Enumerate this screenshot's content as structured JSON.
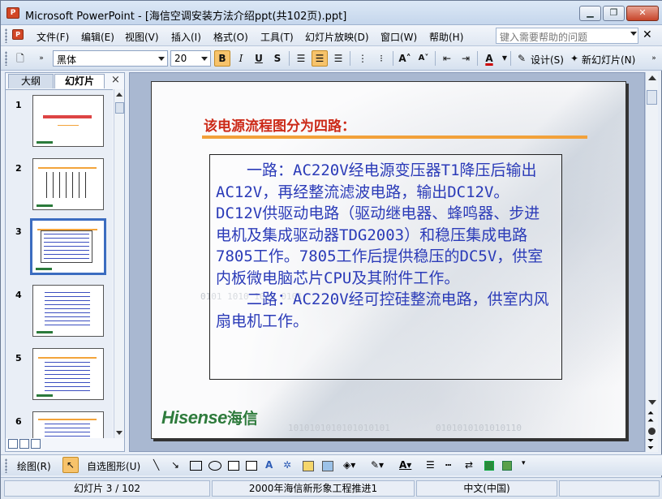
{
  "window": {
    "title": "Microsoft PowerPoint - [海信空调安装方法介绍ppt(共102页).ppt]",
    "icon_label": "P"
  },
  "menu": {
    "items": [
      "文件(F)",
      "编辑(E)",
      "视图(V)",
      "插入(I)",
      "格式(O)",
      "工具(T)",
      "幻灯片放映(D)",
      "窗口(W)",
      "帮助(H)"
    ],
    "help_placeholder": "键入需要帮助的问题",
    "close_glyph": "✕"
  },
  "toolbar": {
    "font_name": "黑体",
    "font_size": "20",
    "bold": "B",
    "italic": "I",
    "underline": "U",
    "shadow": "S",
    "design_label": "设计(S)",
    "new_slide_label": "新幻灯片(N)"
  },
  "left_pane": {
    "tab_outline": "大纲",
    "tab_slides": "幻灯片",
    "close_glyph": "×",
    "thumbnails": [
      {
        "number": "1"
      },
      {
        "number": "2"
      },
      {
        "number": "3",
        "selected": true
      },
      {
        "number": "4"
      },
      {
        "number": "5"
      },
      {
        "number": "6"
      }
    ]
  },
  "slide": {
    "title": "该电源流程图分为四路：",
    "paragraph1": "一路：AC220V经电源变压器T1降压后输出AC12V，再经整流滤波电路，输出DC12V。DC12V供驱动电路（驱动继电器、蜂鸣器、步进电机及集成驱动器TDG2003）和稳压集成电路7805工作。7805工作后提供稳压的DC5V，供室内板微电脑芯片CPU及其附件工作。",
    "paragraph2": "二路：AC220V经可控硅整流电路，供室内风扇电机工作。",
    "logo_en": "Hisense",
    "logo_cn": "海信",
    "binary_1": "0101 1010 1010 0101",
    "binary_2": "1010101010101010101",
    "binary_3": "0101010101010110"
  },
  "drawing_toolbar": {
    "draw_label": "绘图(R)",
    "autoshapes_label": "自选图形(U)"
  },
  "status": {
    "slide_info": "幻灯片 3 / 102",
    "design": "2000年海信新形象工程推进1",
    "language": "中文(中国)"
  },
  "colors": {
    "title_red": "#cc2a18",
    "rule_orange": "#f2a13a",
    "body_blue": "#2b3bb8",
    "logo_green": "#2e7b3c",
    "selection_blue": "#3b6cc0"
  }
}
